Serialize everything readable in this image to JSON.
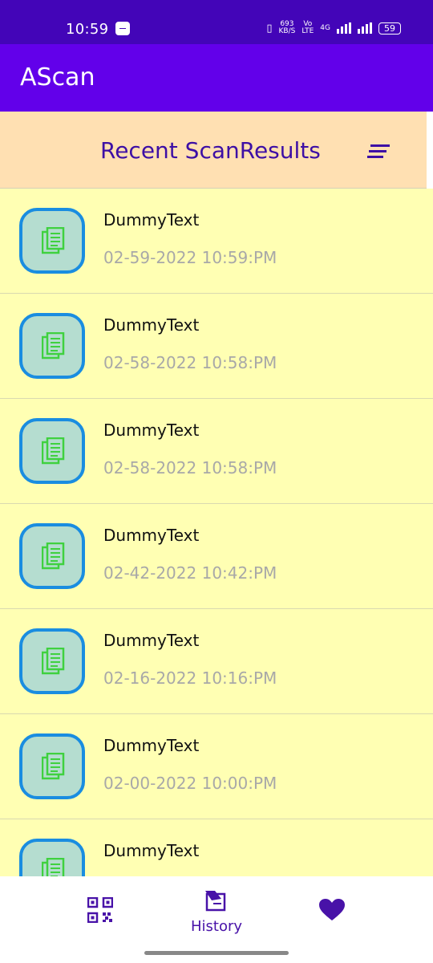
{
  "status_bar": {
    "time": "10:59",
    "net_speed_value": "693",
    "net_speed_unit": "KB/S",
    "volte_top": "Vo",
    "volte_bottom": "LTE",
    "network": "4G",
    "battery": "59"
  },
  "app_bar": {
    "title": "AScan"
  },
  "header": {
    "title": "Recent ScanResults",
    "sort_icon": "sort-icon"
  },
  "list": {
    "items": [
      {
        "name": "DummyText",
        "date": "02-59-2022 10:59:PM",
        "icon": "document-copy-icon"
      },
      {
        "name": "DummyText",
        "date": "02-58-2022 10:58:PM",
        "icon": "document-copy-icon"
      },
      {
        "name": "DummyText",
        "date": "02-58-2022 10:58:PM",
        "icon": "document-copy-icon"
      },
      {
        "name": "DummyText",
        "date": "02-42-2022 10:42:PM",
        "icon": "document-copy-icon"
      },
      {
        "name": "DummyText",
        "date": "02-16-2022 10:16:PM",
        "icon": "document-copy-icon"
      },
      {
        "name": "DummyText",
        "date": "02-00-2022 10:00:PM",
        "icon": "document-copy-icon"
      },
      {
        "name": "DummyText",
        "date": "",
        "icon": "document-copy-icon"
      }
    ]
  },
  "bottom_nav": {
    "items": [
      {
        "icon": "qr-code-icon",
        "label": ""
      },
      {
        "icon": "history-icon",
        "label": "History"
      },
      {
        "icon": "heart-icon",
        "label": ""
      }
    ]
  },
  "colors": {
    "status_bar": "#4305b8",
    "app_bar": "#6200ea",
    "header_bg": "#ffe0b2",
    "list_bg": "#ffffb3",
    "accent_purple": "#4812a8",
    "thumb_border": "#1a8de0",
    "icon_green": "#3fd13f"
  }
}
